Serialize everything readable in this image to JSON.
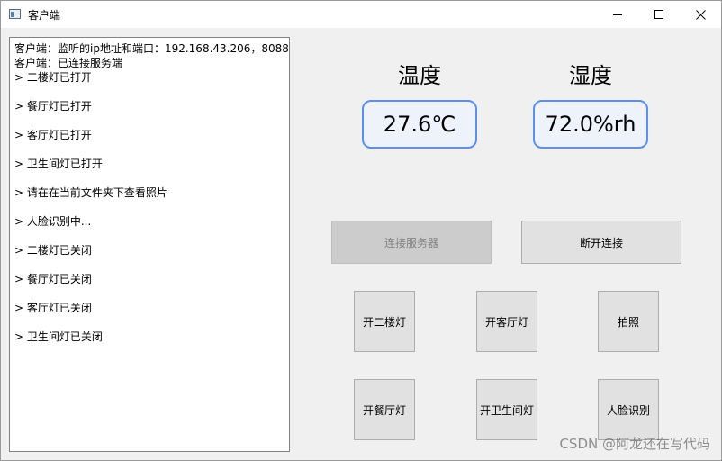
{
  "window": {
    "title": "客户端",
    "icon": "app-window-icon",
    "controls": [
      "minimize-icon",
      "maximize-icon",
      "close-icon"
    ]
  },
  "log": {
    "header_lines": [
      "客户端：监听的ip地址和端口：192.168.43.206，8088",
      "客户端：已连接服务端"
    ],
    "entries": [
      "> 二楼灯已打开",
      "> 餐厅灯已打开",
      "> 客厅灯已打开",
      "> 卫生间灯已打开",
      "> 请在在当前文件夹下查看照片",
      "> 人脸识别中...",
      "> 二楼灯已关闭",
      "> 餐厅灯已关闭",
      "> 客厅灯已关闭",
      "> 卫生间灯已关闭"
    ]
  },
  "sensors": {
    "temperature": {
      "label": "温度",
      "value": "27.6℃"
    },
    "humidity": {
      "label": "湿度",
      "value": "72.0%rh"
    }
  },
  "connection": {
    "connect_label": "连接服务器",
    "disconnect_label": "断开连接"
  },
  "controls": {
    "second_floor_light": "开二楼灯",
    "living_room_light": "开客厅灯",
    "photo": "拍照",
    "dining_room_light": "开餐厅灯",
    "bathroom_light": "开卫生间灯",
    "face_recognition": "人脸识别"
  },
  "watermark": "CSDN @阿龙还在写代码",
  "colors": {
    "sensor_border": "#5b8ff0",
    "sensor_bg": "#eef2fb",
    "button_bg": "#e1e1e1",
    "disabled_bg": "#cccccc"
  }
}
